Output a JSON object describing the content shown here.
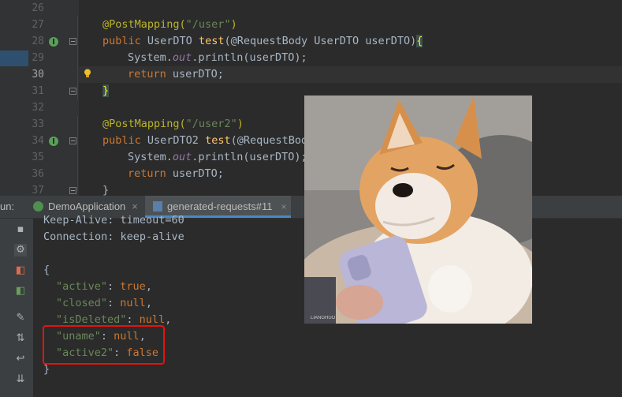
{
  "editor": {
    "lines": [
      {
        "num": "26"
      },
      {
        "num": "27",
        "ann": "@PostMapping(",
        "str": "\"/user\"",
        "close": ")"
      },
      {
        "num": "28",
        "kw": "public ",
        "type": "UserDTO ",
        "fn": "test",
        "rest": "(@RequestBody UserDTO userDTO)",
        "brace": "{"
      },
      {
        "num": "29",
        "pre": "System.",
        "it": "out",
        "rest": ".println(userDTO);"
      },
      {
        "num": "30",
        "kw": "return ",
        "rest": "userDTO;"
      },
      {
        "num": "31",
        "brace": "}"
      },
      {
        "num": "32"
      },
      {
        "num": "33",
        "ann": "@PostMapping(",
        "str": "\"/user2\"",
        "close": ")"
      },
      {
        "num": "34",
        "kw": "public ",
        "type": "UserDTO2 ",
        "fn": "test",
        "rest": "(@RequestBody"
      },
      {
        "num": "35",
        "pre": "System.",
        "it": "out",
        "rest": ".println(userDTO);"
      },
      {
        "num": "36",
        "kw": "return ",
        "rest": "userDTO;"
      },
      {
        "num": "37",
        "brace": "}"
      }
    ]
  },
  "run_panel": {
    "label": "un:",
    "tabs": [
      {
        "label": "DemoApplication",
        "close": "×"
      },
      {
        "label": "generated-requests#11",
        "close": "×"
      }
    ]
  },
  "output": {
    "header_lines": [
      "Keep-Alive: timeout=60",
      "Connection: keep-alive"
    ],
    "open_brace": "{",
    "fields": [
      {
        "key": "\"active\"",
        "sep": ": ",
        "value": "true",
        "comma": ","
      },
      {
        "key": "\"closed\"",
        "sep": ": ",
        "value": "null",
        "comma": ","
      },
      {
        "key": "\"isDeleted\"",
        "sep": ": ",
        "value": "null",
        "comma": ","
      },
      {
        "key": "\"uname\"",
        "sep": ": ",
        "value": "null",
        "comma": ","
      },
      {
        "key": "\"active2\"",
        "sep": ": ",
        "value": "false",
        "comma": ""
      }
    ],
    "close_brace": "}"
  },
  "photo": {
    "watermark": "LIANGHUO"
  },
  "colors": {
    "editor_bg": "#2b2b2b",
    "annotation": "#bbb529",
    "string": "#6a8759",
    "keyword": "#cc7832",
    "function": "#ffc66d",
    "highlight_box": "#e8120c",
    "tab_accent": "#4a88c7"
  }
}
